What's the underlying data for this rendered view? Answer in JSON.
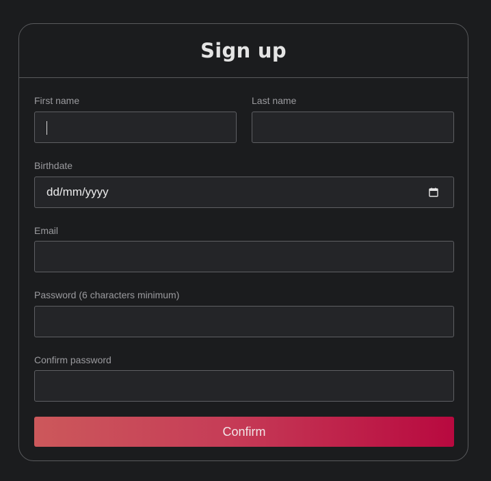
{
  "form": {
    "title": "Sign up",
    "fields": {
      "first_name": {
        "label": "First name",
        "value": ""
      },
      "last_name": {
        "label": "Last name",
        "value": ""
      },
      "birthdate": {
        "label": "Birthdate",
        "value": "dd/mm/yyyy"
      },
      "email": {
        "label": "Email",
        "value": ""
      },
      "password": {
        "label": "Password (6 characters minimum)",
        "value": ""
      },
      "confirm_password": {
        "label": "Confirm password",
        "value": ""
      }
    },
    "confirm_label": "Confirm"
  },
  "icons": {
    "calendar": "calendar-icon"
  },
  "colors": {
    "background": "#1b1c1e",
    "input_background": "#242528",
    "button_gradient_start": "#cc585b",
    "button_gradient_end": "#b8093f"
  }
}
